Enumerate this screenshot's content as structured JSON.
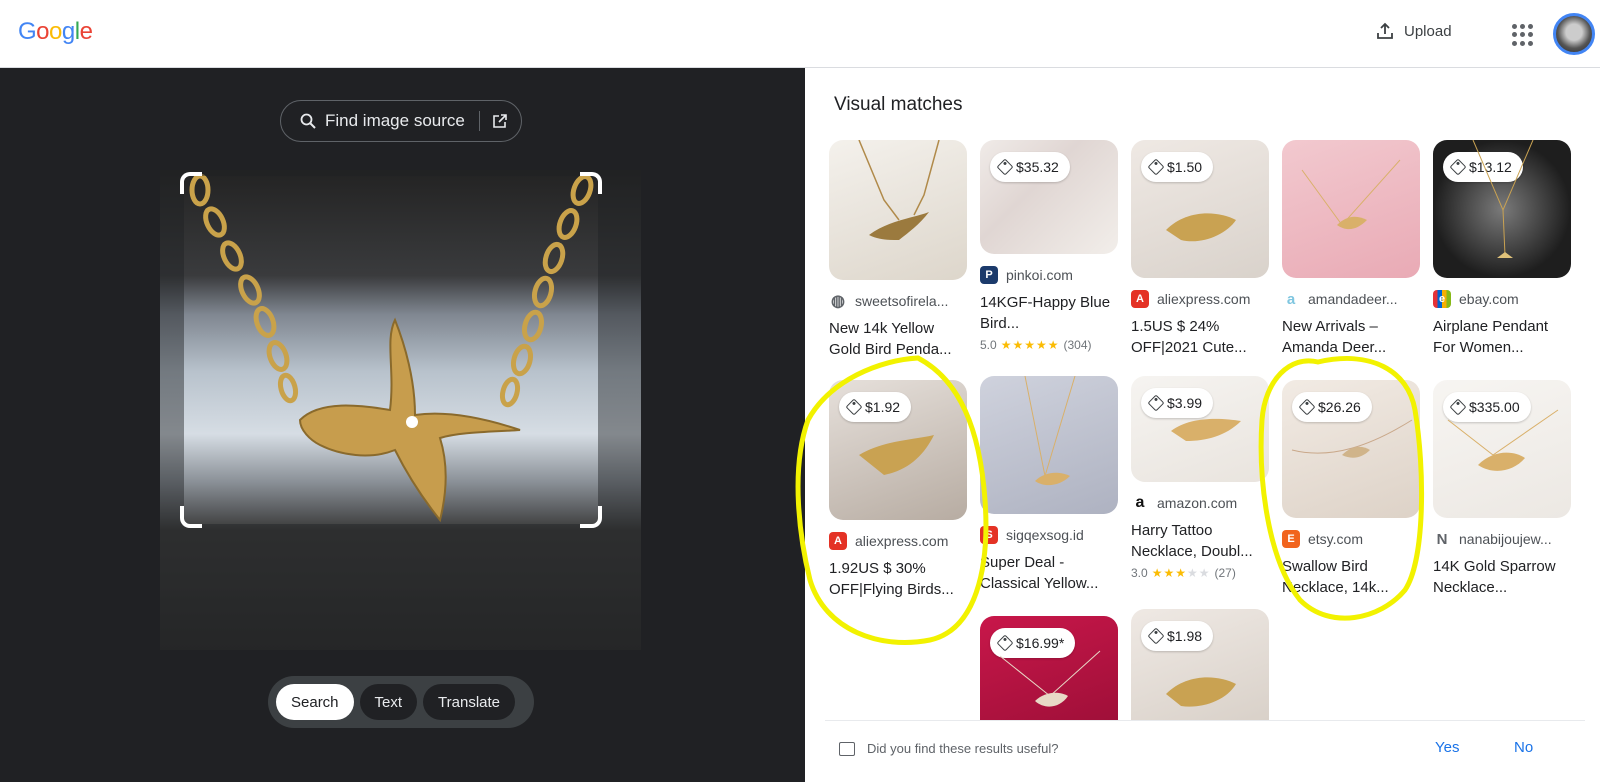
{
  "header": {
    "logo_letters": [
      {
        "ch": "G",
        "color": "#4285f4"
      },
      {
        "ch": "o",
        "color": "#ea4335"
      },
      {
        "ch": "o",
        "color": "#fbbc05"
      },
      {
        "ch": "g",
        "color": "#4285f4"
      },
      {
        "ch": "l",
        "color": "#34a853"
      },
      {
        "ch": "e",
        "color": "#ea4335"
      }
    ],
    "upload_label": "Upload"
  },
  "left": {
    "find_source_label": "Find image source",
    "modes": [
      "Search",
      "Text",
      "Translate"
    ],
    "active_mode": "Search"
  },
  "right": {
    "title": "Visual matches",
    "feedback_question": "Did you find these results useful?",
    "yes_label": "Yes",
    "no_label": "No"
  },
  "results": [
    {
      "price": "",
      "site": "sweetsofirela...",
      "fav_color": "#5f6368",
      "fav_char": "◍",
      "title": "New 14k Yellow Gold Bird Penda...",
      "rating": "",
      "rating_count": ""
    },
    {
      "price": "$35.32",
      "site": "pinkoi.com",
      "fav_color": "#1b3a6b",
      "fav_char": "P",
      "title": "14KGF-Happy Blue Bird...",
      "rating": "5.0",
      "rating_count": "(304)"
    },
    {
      "price": "$1.50",
      "site": "aliexpress.com",
      "fav_color": "#e43225",
      "fav_char": "A",
      "title": "1.5US $ 24% OFF|2021 Cute...",
      "rating": "",
      "rating_count": ""
    },
    {
      "price": "",
      "site": "amandadeer...",
      "fav_color": "#7fc6e0",
      "fav_char": "a",
      "title": "New Arrivals – Amanda Deer...",
      "rating": "",
      "rating_count": ""
    },
    {
      "price": "$13.12",
      "site": "ebay.com",
      "fav_color": "#e53238",
      "fav_char": "e",
      "title": "Airplane Pendant For Women...",
      "rating": "",
      "rating_count": ""
    },
    {
      "price": "$1.92",
      "site": "aliexpress.com",
      "fav_color": "#e43225",
      "fav_char": "A",
      "title": "1.92US $ 30% OFF|Flying Birds...",
      "rating": "",
      "rating_count": ""
    },
    {
      "price": "",
      "site": "sigqexsog.id",
      "fav_color": "#e43225",
      "fav_char": "S",
      "title": "Super Deal - Classical Yellow...",
      "rating": "",
      "rating_count": ""
    },
    {
      "price": "$3.99",
      "site": "amazon.com",
      "fav_color": "#111111",
      "fav_char": "a",
      "title": "Harry Tattoo Necklace, Doubl...",
      "rating": "3.0",
      "rating_count": "(27)"
    },
    {
      "price": "$26.26",
      "site": "etsy.com",
      "fav_color": "#f1641e",
      "fav_char": "E",
      "title": "Swallow Bird Necklace, 14k...",
      "rating": "",
      "rating_count": ""
    },
    {
      "price": "$335.00",
      "site": "nanabijoujew...",
      "fav_color": "#5f6368",
      "fav_char": "N",
      "title": "14K Gold Sparrow Necklace...",
      "rating": "",
      "rating_count": ""
    },
    {
      "price": "$16.99*",
      "site": "",
      "fav_color": "",
      "fav_char": "",
      "title": "",
      "rating": "",
      "rating_count": ""
    },
    {
      "price": "$1.98",
      "site": "",
      "fav_color": "",
      "fav_char": "",
      "title": "",
      "rating": "",
      "rating_count": ""
    }
  ],
  "colors": {
    "annotation": "#f2f200",
    "link": "#1a73e8",
    "dark_panel": "#202124"
  }
}
